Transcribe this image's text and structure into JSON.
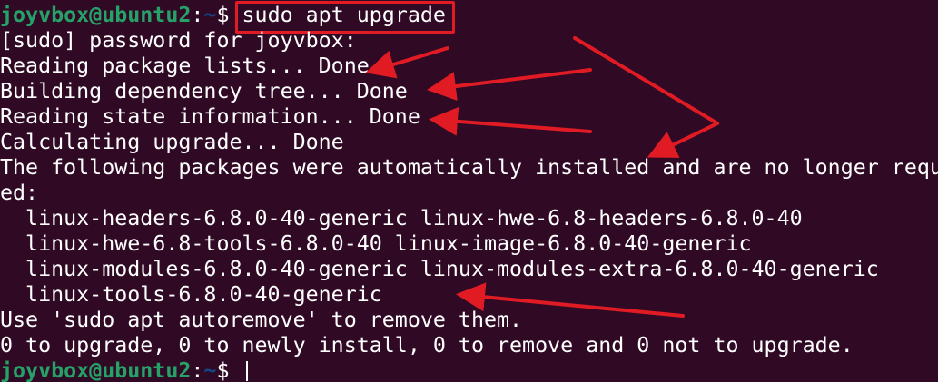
{
  "terminal": {
    "background": "#300a24",
    "prompt": {
      "user_host": "joyvbox@ubuntu2",
      "colon": ":",
      "path": "~",
      "dollar": "$ "
    },
    "command": "sudo apt upgrade",
    "output": [
      "[sudo] password for joyvbox:",
      "Reading package lists... Done",
      "Building dependency tree... Done",
      "Reading state information... Done",
      "Calculating upgrade... Done",
      "The following packages were automatically installed and are no longer requ",
      "ed:",
      "  linux-headers-6.8.0-40-generic linux-hwe-6.8-headers-6.8.0-40",
      "  linux-hwe-6.8-tools-6.8.0-40 linux-image-6.8.0-40-generic",
      "  linux-modules-6.8.0-40-generic linux-modules-extra-6.8.0-40-generic",
      "  linux-tools-6.8.0-40-generic",
      "Use 'sudo apt autoremove' to remove them.",
      "0 to upgrade, 0 to newly install, 0 to remove and 0 not to upgrade."
    ],
    "colors": {
      "user_host": "#26a269",
      "path": "#12488b",
      "text": "#ffffff",
      "annotation": "#e01b24"
    }
  }
}
